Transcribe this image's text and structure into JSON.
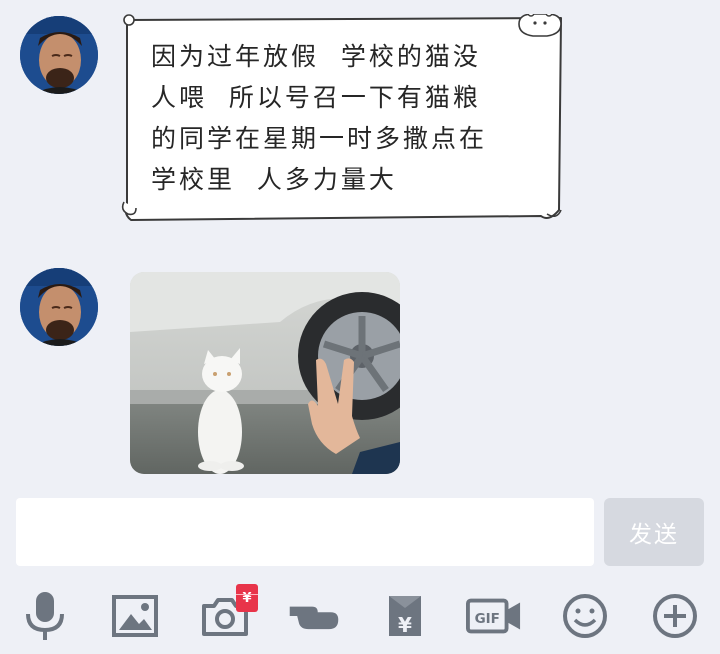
{
  "messages": [
    {
      "type": "text",
      "text": "因为过年放假  学校的猫没\n人喂  所以号召一下有猫粮\n的同学在星期一时多撒点在\n学校里  人多力量大"
    },
    {
      "type": "image"
    }
  ],
  "composer": {
    "input_value": "",
    "send_label": "发送"
  },
  "toolbar": {
    "items": [
      "microphone-icon",
      "image-icon",
      "camera-icon",
      "poke-hand-icon",
      "red-packet-icon",
      "gif-icon",
      "emoji-icon",
      "plus-icon"
    ],
    "camera_badge": "¥",
    "gif_label": "GIF",
    "red_packet_symbol": "¥"
  },
  "colors": {
    "background": "#eef0f6",
    "send_button": "#d6d9e0",
    "badge": "#e8344a",
    "icon": "#6d7580"
  }
}
